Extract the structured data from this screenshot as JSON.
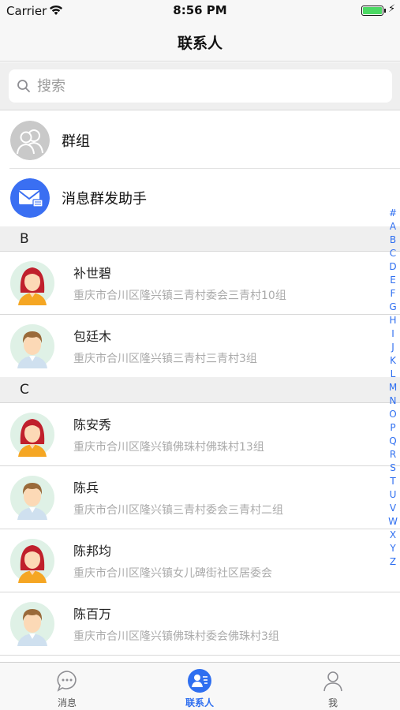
{
  "status_bar": {
    "carrier": "Carrier",
    "time": "8:56 PM",
    "battery_level": 1.0
  },
  "nav": {
    "title": "联系人"
  },
  "search": {
    "placeholder": "搜索",
    "value": ""
  },
  "entries": [
    {
      "label": "群组",
      "icon": "group-icon"
    },
    {
      "label": "消息群发助手",
      "icon": "mail-broadcast-icon"
    }
  ],
  "sections": [
    {
      "letter": "B",
      "contacts": [
        {
          "name": "补世碧",
          "address": "重庆市合川区隆兴镇三青村委会三青村10组",
          "avatar": "female-avatar"
        },
        {
          "name": "包廷木",
          "address": "重庆市合川区隆兴镇三青村三青村3组",
          "avatar": "male-avatar"
        }
      ]
    },
    {
      "letter": "C",
      "contacts": [
        {
          "name": "陈安秀",
          "address": "重庆市合川区隆兴镇佛珠村佛珠村13组",
          "avatar": "female-avatar"
        },
        {
          "name": "陈兵",
          "address": "重庆市合川区隆兴镇三青村委会三青村二组",
          "avatar": "male-avatar"
        },
        {
          "name": "陈邦均",
          "address": "重庆市合川区隆兴镇女儿碑街社区居委会",
          "avatar": "female-avatar"
        },
        {
          "name": "陈百万",
          "address": "重庆市合川区隆兴镇佛珠村委会佛珠村3组",
          "avatar": "male-avatar"
        }
      ]
    }
  ],
  "index": [
    "#",
    "A",
    "B",
    "C",
    "D",
    "E",
    "F",
    "G",
    "H",
    "I",
    "J",
    "K",
    "L",
    "M",
    "N",
    "O",
    "P",
    "Q",
    "R",
    "S",
    "T",
    "U",
    "V",
    "W",
    "X",
    "Y",
    "Z"
  ],
  "tabs": [
    {
      "label": "消息",
      "icon": "chat-bubble-icon",
      "active": false
    },
    {
      "label": "联系人",
      "icon": "contacts-icon",
      "active": true
    },
    {
      "label": "我",
      "icon": "person-icon",
      "active": false
    }
  ],
  "colors": {
    "accent": "#2f6ff0",
    "battery": "#4cd964",
    "female_hair": "#c0202c",
    "female_shirt": "#f5a623",
    "male_hair": "#9a6a3a",
    "avatar_bg": "#dff1e6"
  }
}
